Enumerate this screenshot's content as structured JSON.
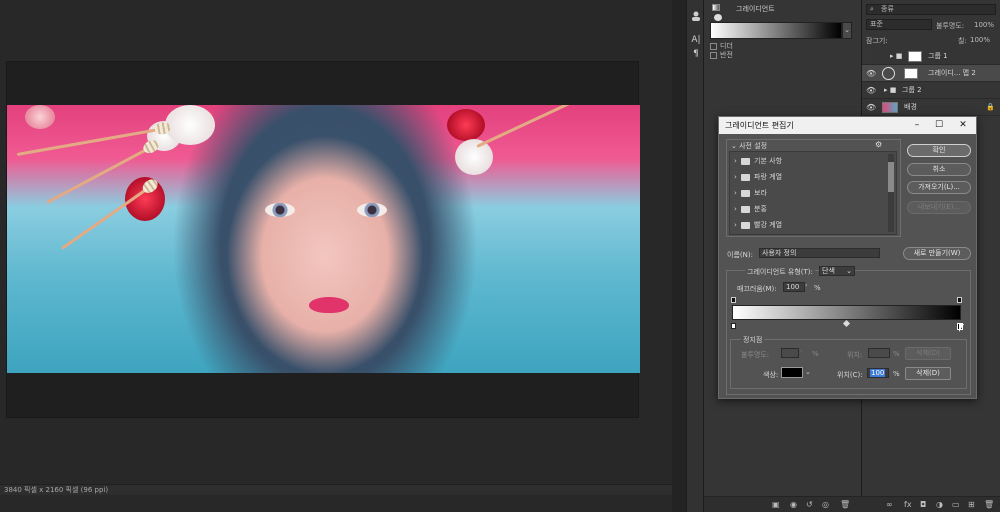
{
  "status_bar": {
    "text": "3840 픽셀 x 2160 픽셀 (96 ppi)"
  },
  "tools_strip": {
    "icons": [
      "person-icon",
      "type-ai-icon",
      "paragraph-icon"
    ],
    "labels": [
      "A|",
      "¶"
    ]
  },
  "properties_panel": {
    "dither_label": "디더",
    "reverse_label": "반전",
    "gradient_name": "그레이디언트"
  },
  "layers_panel": {
    "filter_label": "종류",
    "blend_mode": "표준",
    "opacity_label": "불투명도:",
    "opacity_value": "100%",
    "lock_label": "잠그기:",
    "fill_label": "칠:",
    "fill_value": "100%",
    "layers": [
      {
        "name": "그룹 1",
        "visible": false
      },
      {
        "name": "그레이디... 맵 2",
        "visible": true
      },
      {
        "name": "그룹 2",
        "visible": true
      },
      {
        "name": "배경",
        "visible": true
      }
    ]
  },
  "dialog": {
    "title": "그레이디언트 편집기",
    "presets_label": "사전 설정",
    "presets": [
      "기본 사항",
      "파랑 계열",
      "보라",
      "분홍",
      "빨강 계열"
    ],
    "ok_label": "확인",
    "cancel_label": "취소",
    "load_label": "가져오기(L)...",
    "export_label": "내보내기(E)...",
    "name_label": "이름(N):",
    "name_value": "사용자 정의",
    "new_label": "새로 만들기(W)",
    "type_label": "그레이디언트 유형(T):",
    "type_value": "단색",
    "smoothness_label": "매끄러움(M):",
    "smoothness_value": "100",
    "smoothness_unit": "%",
    "stops_label": "정지점",
    "opacity_label": "불투명도:",
    "opacity_unit": "%",
    "position_label": "위치:",
    "position_unit": "%",
    "delete_label": "삭제(D)",
    "color_label": "색상:",
    "color_position_label": "위치(C):",
    "color_position_value": "100",
    "color_position_unit": "%",
    "color_delete_label": "삭제(D)",
    "stop_color": "#000000"
  },
  "colors": {
    "accent_selection": "#3d7bd6",
    "panel": "#353535",
    "dialog": "#535353"
  }
}
